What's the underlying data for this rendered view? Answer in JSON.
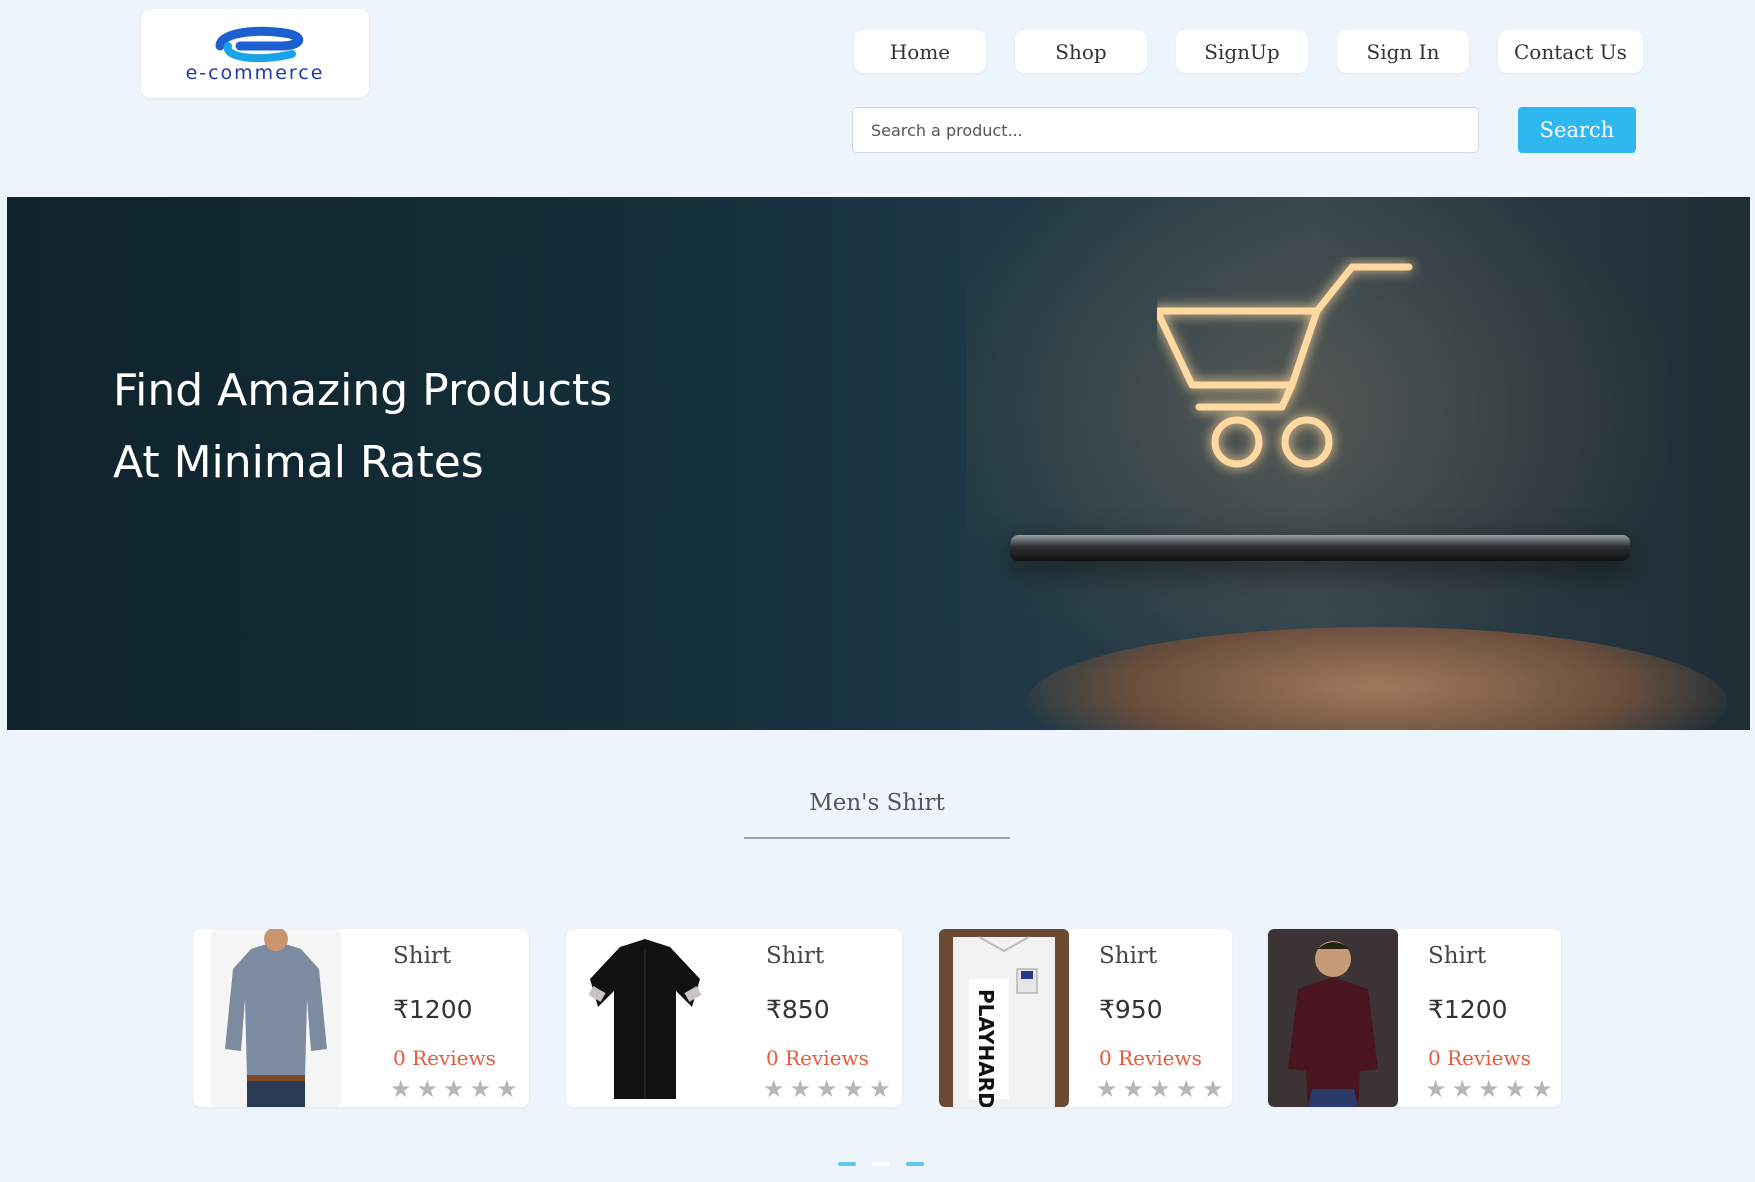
{
  "header": {
    "logo_text": "e-commerce",
    "nav": [
      {
        "label": "Home"
      },
      {
        "label": "Shop"
      },
      {
        "label": "SignUp"
      },
      {
        "label": "Sign In"
      },
      {
        "label": "Contact Us"
      }
    ],
    "search": {
      "placeholder": "Search a product...",
      "value": "",
      "button_label": "Search"
    }
  },
  "hero": {
    "line1": "Find Amazing Products",
    "line2": "At Minimal Rates"
  },
  "section": {
    "title": "Men's Shirt"
  },
  "products": [
    {
      "name": "Shirt",
      "price": "₹1200",
      "reviews": "0 Reviews",
      "rating": 0
    },
    {
      "name": "Shirt",
      "price": "₹850",
      "reviews": "0 Reviews",
      "rating": 0
    },
    {
      "name": "Shirt",
      "price": "₹950",
      "reviews": "0 Reviews",
      "rating": 0
    },
    {
      "name": "Shirt",
      "price": "₹1200",
      "reviews": "0 Reviews",
      "rating": 0
    }
  ],
  "carousel": {
    "active_index": 0,
    "count": 3
  },
  "colors": {
    "accent": "#2eb8ef",
    "background": "#eef4fb",
    "reviews": "#e55a3c",
    "star_empty": "#b7b7b7"
  }
}
